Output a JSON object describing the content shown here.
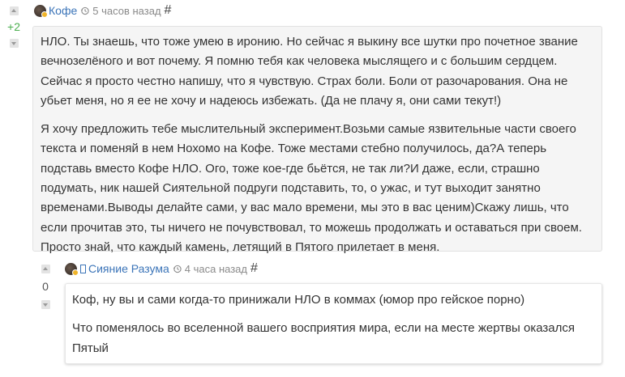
{
  "comments": [
    {
      "score": "+2",
      "author": "Кофе",
      "time": "5 часов назад",
      "permalink": "#",
      "paragraphs": [
        "НЛО. Ты знаешь, что тоже умею в иронию. Но сейчас я выкину все шутки про почетное звание вечнозелёного и вот почему. Я помню тебя как человека мыслящего и с большим сердцем. Сейчас я просто честно напишу, что я чувствую. Страх боли. Боли от разочарования. Она не убьет меня, но я ее не хочу и надеюсь избежать. (Да не плачу я, они сами текут!)",
        "Я хочу предложить тебе мыслительный эксперимент.Возьми самые язвительные части своего текста и поменяй в нем Нохомо на Кофе. Тоже местами стебно получилось, да?А теперь подставь вместо Кофе НЛО. Ого, тоже кое-где бьётся, не так ли?И даже, если, страшно подумать, ник нашей Сиятельной подруги подставить, то, о ужас, и тут выходит занятно временами.Выводы делайте сами, у вас мало времени, мы это в вас ценим)Скажу лишь, что если прочитав это, ты ничего не почувствовал, то можешь продолжать и оставаться при своем. Просто знай, что каждый камень, летящий в Пятого прилетает в меня."
      ]
    },
    {
      "score": "0",
      "author": "Сияние Разума",
      "time": "4 часа назад",
      "permalink": "#",
      "paragraphs": [
        "Коф, ну вы и сами когда-то принижали НЛО в коммах (юмор про гейское порно)",
        "Что поменялось во вселенной вашего восприятия мира, если на месте жертвы оказался Пятый"
      ]
    }
  ],
  "icons": {
    "upvote": "arrow-up-icon",
    "downvote": "arrow-down-icon",
    "history": "history-clock-icon",
    "avatar_status": "status-dot-icon"
  },
  "colors": {
    "author_link": "#3b74b8",
    "positive_score": "#4caf50",
    "bubble_bg": "#f5f5f5",
    "timestamp": "#8a8a8a"
  }
}
